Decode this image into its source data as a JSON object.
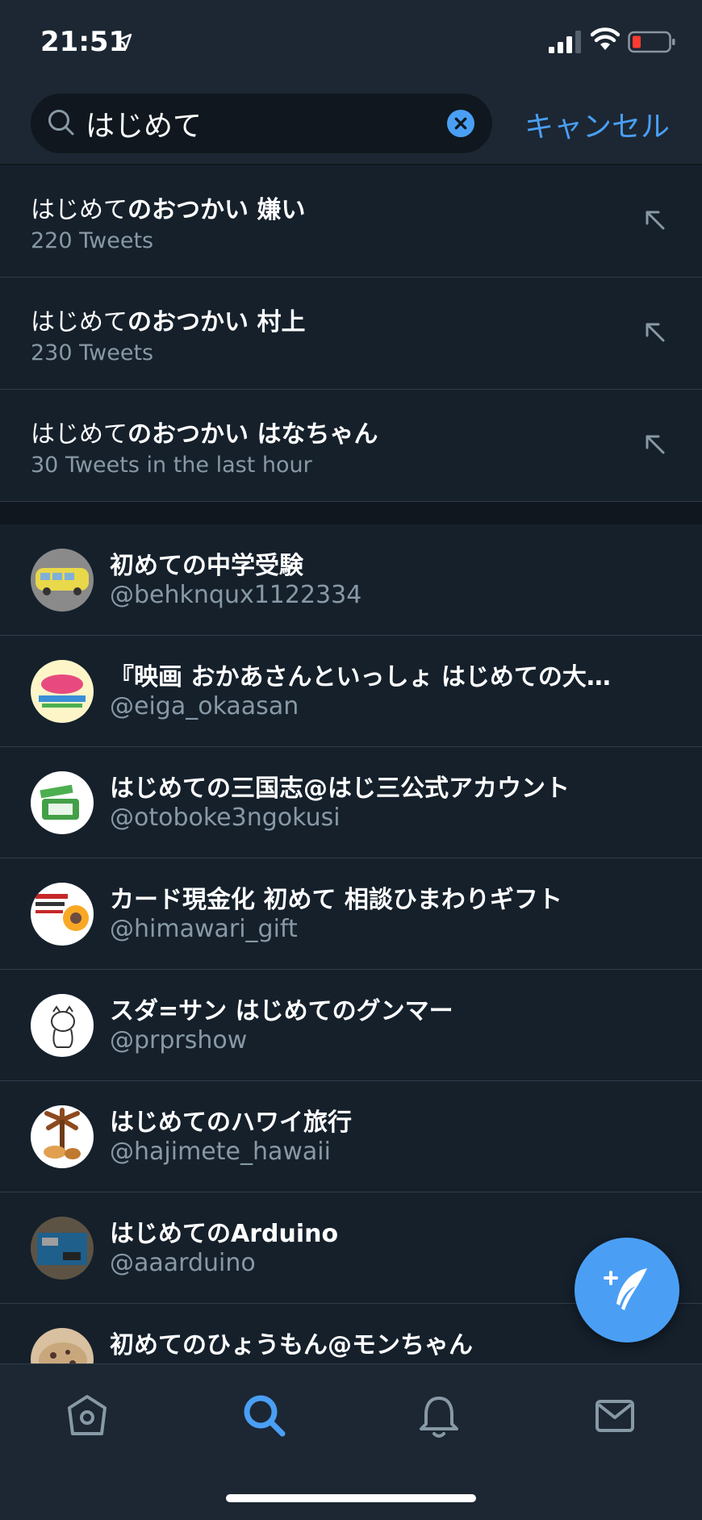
{
  "status_bar": {
    "time": "21:51"
  },
  "search": {
    "query": "はじめて",
    "cancel_label": "キャンセル"
  },
  "suggestions": [
    {
      "prefix": "はじめて",
      "suffix": "のおつかい 嫌い",
      "count": "220 Tweets"
    },
    {
      "prefix": "はじめて",
      "suffix": "のおつかい 村上",
      "count": "230 Tweets"
    },
    {
      "prefix": "はじめて",
      "suffix": "のおつかい はなちゃん",
      "count": "30 Tweets in the last hour"
    }
  ],
  "users": [
    {
      "name": "初めての中学受験",
      "handle": "@behknqux1122334"
    },
    {
      "name": "『映画 おかあさんといっしょ はじめての大…",
      "handle": "@eiga_okaasan"
    },
    {
      "name": "はじめての三国志@はじ三公式アカウント",
      "handle": "@otoboke3ngokusi"
    },
    {
      "name": "カード現金化 初めて 相談ひまわりギフト",
      "handle": "@himawari_gift"
    },
    {
      "name": "スダ=サン はじめてのグンマー",
      "handle": "@prprshow"
    },
    {
      "name": "はじめてのハワイ旅行",
      "handle": "@hajimete_hawaii"
    },
    {
      "name": "はじめてのArduino",
      "handle": "@aaarduino"
    },
    {
      "name": "初めてのひょうもん@モンちゃん",
      "handle": ""
    }
  ],
  "colors": {
    "background": "#15202b",
    "accent": "#4a9ff5",
    "secondary_text": "#8899a6"
  },
  "tabs": [
    {
      "icon": "home-icon",
      "active": false
    },
    {
      "icon": "search-icon",
      "active": true
    },
    {
      "icon": "bell-icon",
      "active": false
    },
    {
      "icon": "mail-icon",
      "active": false
    }
  ]
}
